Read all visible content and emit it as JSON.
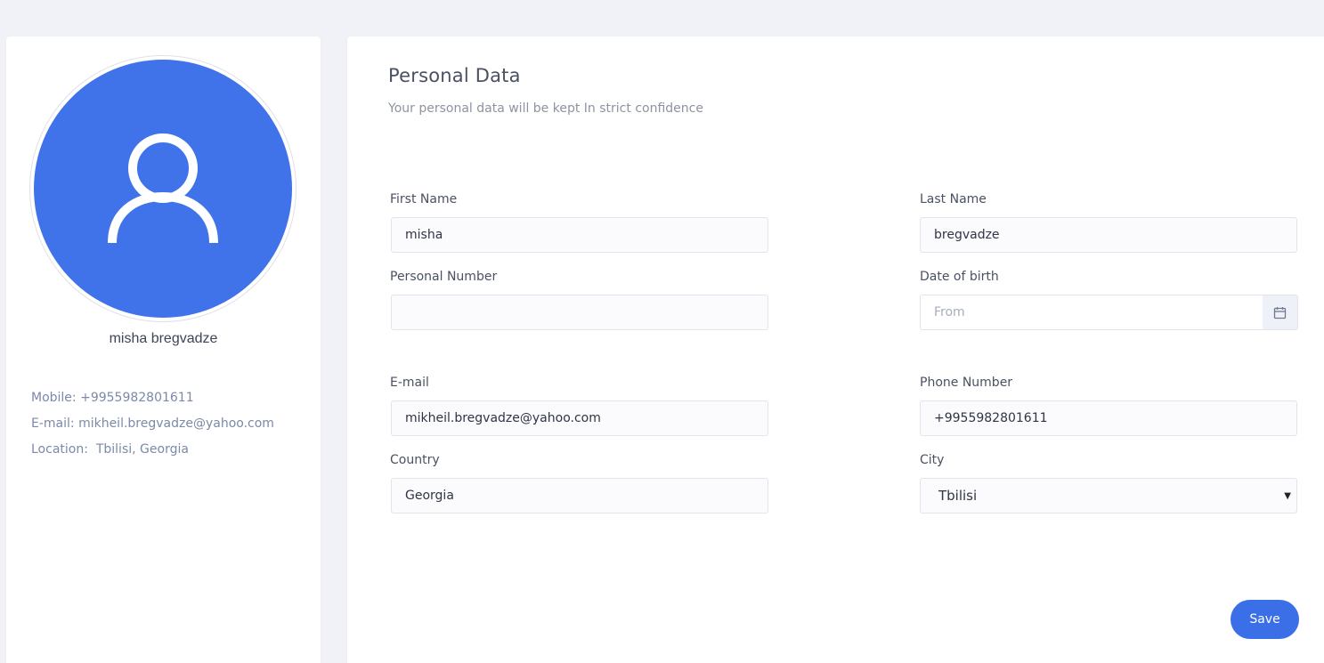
{
  "profile": {
    "avatar_icon": "user-icon",
    "avatar_color": "#4073ea",
    "name": "misha bregvadze",
    "mobile_label": "Mobile: ",
    "mobile": "+9955982801611",
    "email_label": "E-mail: ",
    "email": "mikheil.bregvadze@yahoo.com",
    "location_label": "Location:  ",
    "location": "Tbilisi, Georgia"
  },
  "form": {
    "title": "Personal Data",
    "subtitle": "Your personal data will be kept In strict confidence",
    "first_name": {
      "label": "First Name",
      "value": "misha"
    },
    "last_name": {
      "label": "Last Name",
      "value": "bregvadze"
    },
    "personal_number": {
      "label": "Personal Number",
      "value": ""
    },
    "date_of_birth": {
      "label": "Date of birth",
      "value": "",
      "placeholder": "From",
      "icon": "calendar-icon"
    },
    "email": {
      "label": "E-mail",
      "value": "mikheil.bregvadze@yahoo.com"
    },
    "phone": {
      "label": "Phone Number",
      "value": "+9955982801611"
    },
    "country": {
      "label": "Country",
      "value": "Georgia"
    },
    "city": {
      "label": "City",
      "selected": "Tbilisi",
      "arrow_icon": "dropdown-arrow-icon"
    },
    "save_label": "Save",
    "accent_color": "#3b6fe8"
  }
}
